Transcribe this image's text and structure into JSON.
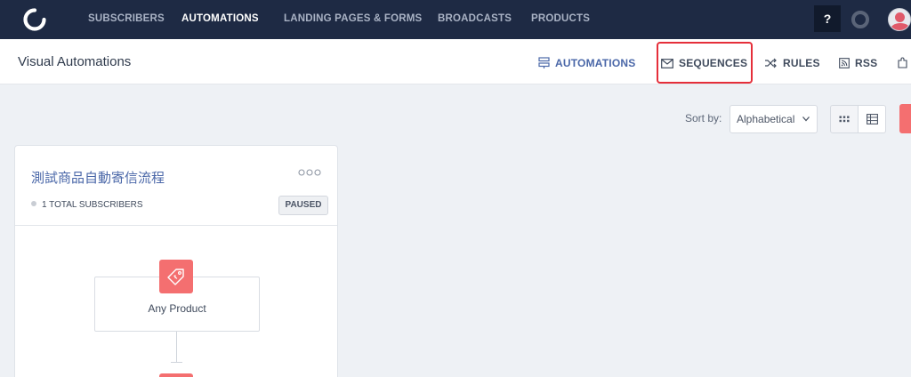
{
  "nav": {
    "items": [
      {
        "label": "SUBSCRIBERS"
      },
      {
        "label": "AUTOMATIONS"
      },
      {
        "label": "LANDING PAGES & FORMS"
      },
      {
        "label": "BROADCASTS"
      },
      {
        "label": "PRODUCTS"
      }
    ],
    "help_label": "?"
  },
  "header": {
    "title": "Visual Automations",
    "tabs": [
      {
        "label": "AUTOMATIONS"
      },
      {
        "label": "SEQUENCES"
      },
      {
        "label": "RULES"
      },
      {
        "label": "RSS"
      }
    ]
  },
  "toolbar": {
    "sort_label": "Sort by:",
    "sort_value": "Alphabetical"
  },
  "card": {
    "title": "測試商品自動寄信流程",
    "stat": "1 TOTAL SUBSCRIBERS",
    "status": "PAUSED",
    "trigger_label": "Any Product"
  },
  "colors": {
    "nav_bg": "#1e2a44",
    "accent_red": "#f46f70",
    "link_blue": "#4a67a8",
    "highlight": "#e52f3a"
  }
}
